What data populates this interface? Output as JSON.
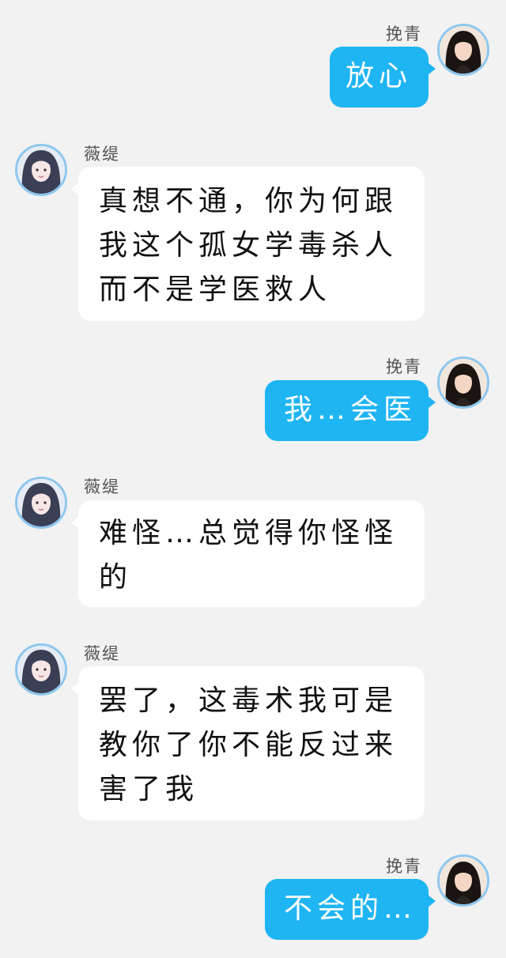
{
  "messages": [
    {
      "sender": "挽青",
      "text": "放心"
    },
    {
      "sender": "薇缇",
      "lines": [
        "真想不通，你为何跟",
        "我这个孤女学毒杀人",
        "而不是学医救人"
      ]
    },
    {
      "sender": "挽青",
      "text": "我…会医"
    },
    {
      "sender": "薇缇",
      "lines": [
        "难怪…总觉得你怪怪",
        "的"
      ]
    },
    {
      "sender": "薇缇",
      "lines": [
        "罢了，这毒术我可是",
        "教你了你不能反过来",
        "害了我"
      ]
    },
    {
      "sender": "挽青",
      "text": "不会的…"
    }
  ],
  "colors": {
    "background": "#f2f2f2",
    "outgoing_bubble": "#1fb5f3",
    "incoming_bubble": "#ffffff",
    "avatar_ring": "#8ec7ee"
  }
}
